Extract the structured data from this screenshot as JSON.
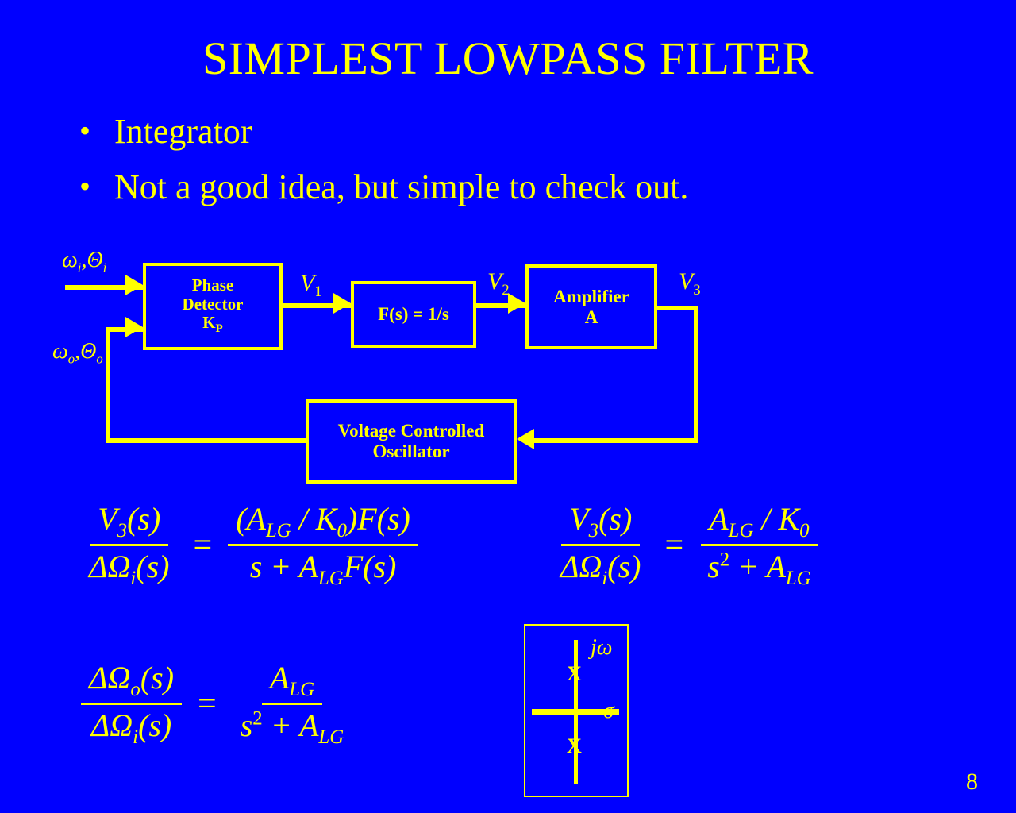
{
  "slide": {
    "background_color": "#0000ff",
    "foreground_color": "#ffff00",
    "title": "SIMPLEST LOWPASS FILTER",
    "page_number": "8"
  },
  "bullets": [
    {
      "marker": "•",
      "text": "Integrator"
    },
    {
      "marker": "•",
      "text": "Not a good idea, but simple to check out."
    }
  ],
  "diagram": {
    "blocks": [
      {
        "id": "phase-detector",
        "lines": [
          "Phase",
          "Detector",
          "K"
        ],
        "subscript": "P"
      },
      {
        "id": "loop-filter",
        "lines": [
          "F(s) = 1/s"
        ]
      },
      {
        "id": "amplifier",
        "lines": [
          "Amplifier",
          "A"
        ]
      },
      {
        "id": "vco",
        "lines": [
          "Voltage Controlled",
          "Oscillator"
        ]
      }
    ],
    "input_labels": [
      {
        "id": "input-ref",
        "base": "ω",
        "sub1": "i",
        "sep": ",",
        "base2": "Θ",
        "sub2": "i"
      },
      {
        "id": "input-fb",
        "base": "ω",
        "sub1": "o",
        "sep": ",",
        "base2": "Θ",
        "sub2": "o"
      }
    ],
    "signal_labels": [
      {
        "id": "v1",
        "symbol": "V",
        "sub": "1"
      },
      {
        "id": "v2",
        "symbol": "V",
        "sub": "2"
      },
      {
        "id": "v3",
        "symbol": "V",
        "sub": "3"
      }
    ]
  },
  "equations": [
    {
      "id": "eq-v3-over-omega-i-general",
      "lhs": {
        "num": "V₃(s)",
        "den": "ΔΩᵢ(s)"
      },
      "relation": "=",
      "rhs": {
        "num": "(A_LG / K₀)F(s)",
        "den": "s + A_LG F(s)"
      },
      "parts": {
        "lhs_num_sym": "V",
        "lhs_num_sub": "3",
        "lhs_num_arg": "(s)",
        "lhs_den_sym": "ΔΩ",
        "lhs_den_sub": "i",
        "lhs_den_arg": "(s)",
        "rhs_num": "(A",
        "rhs_num_sub": "LG",
        "rhs_num_mid": " / K",
        "rhs_num_sub2": "0",
        "rhs_num_tail": ")F(s)",
        "rhs_den": "s + A",
        "rhs_den_sub": "LG",
        "rhs_den_tail": "F(s)"
      }
    },
    {
      "id": "eq-v3-over-omega-i-integrator",
      "lhs": {
        "num": "V₃(s)",
        "den": "ΔΩᵢ(s)"
      },
      "relation": "=",
      "rhs": {
        "num": "A_LG / K₀",
        "den": "s² + A_LG"
      },
      "parts": {
        "lhs_num_sym": "V",
        "lhs_num_sub": "3",
        "lhs_num_arg": "(s)",
        "lhs_den_sym": "ΔΩ",
        "lhs_den_sub": "i",
        "lhs_den_arg": "(s)",
        "rhs_num": "A",
        "rhs_num_sub": "LG",
        "rhs_num_mid": " / K",
        "rhs_num_sub2": "0",
        "rhs_den": "s",
        "rhs_den_sup": "2",
        "rhs_den_mid": " + A",
        "rhs_den_sub": "LG"
      }
    },
    {
      "id": "eq-omega-o-over-omega-i",
      "lhs": {
        "num": "ΔΩₒ(s)",
        "den": "ΔΩᵢ(s)"
      },
      "relation": "=",
      "rhs": {
        "num": "A_LG",
        "den": "s² + A_LG"
      },
      "parts": {
        "lhs_num_sym": "ΔΩ",
        "lhs_num_sub": "o",
        "lhs_num_arg": "(s)",
        "lhs_den_sym": "ΔΩ",
        "lhs_den_sub": "i",
        "lhs_den_arg": "(s)",
        "rhs_num": "A",
        "rhs_num_sub": "LG",
        "rhs_den": "s",
        "rhs_den_sup": "2",
        "rhs_den_mid": " + A",
        "rhs_den_sub": "LG"
      }
    }
  ],
  "splane": {
    "vertical_axis_label": "jω",
    "horizontal_axis_label": "σ",
    "pole_marker": "X",
    "poles": [
      {
        "id": "pole-upper",
        "sigma": 0,
        "jomega": 1,
        "marker": "X"
      },
      {
        "id": "pole-lower",
        "sigma": 0,
        "jomega": -1,
        "marker": "X"
      }
    ]
  }
}
